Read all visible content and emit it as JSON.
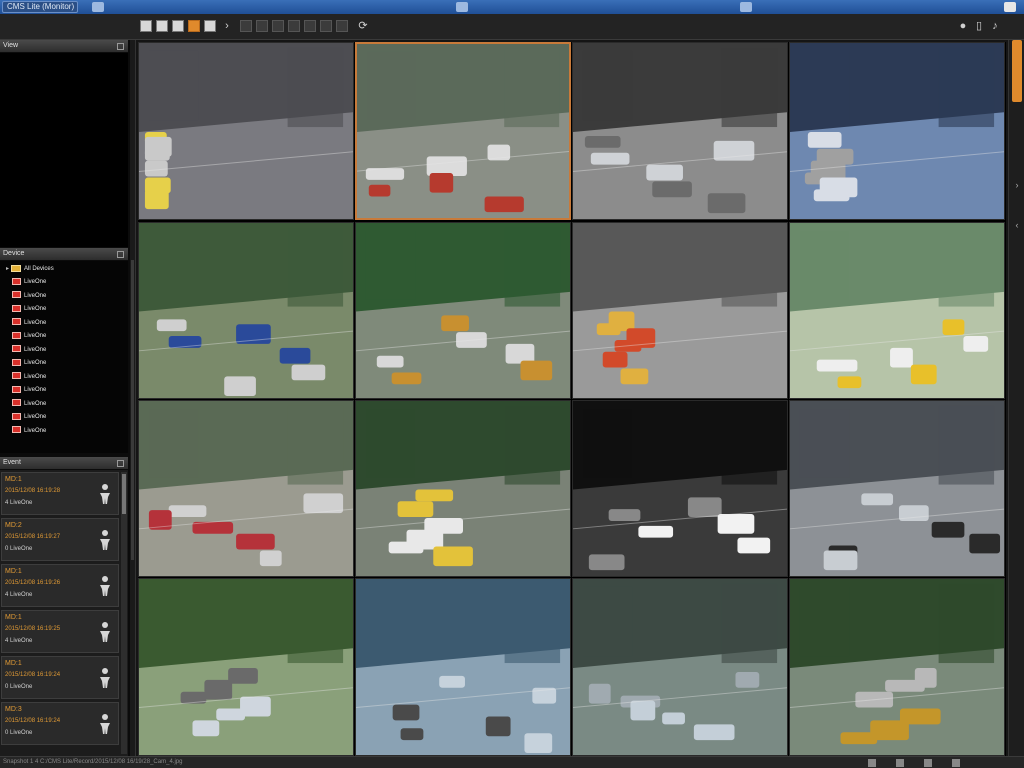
{
  "window": {
    "title": "CMS Lite (Monitor)"
  },
  "toolbar": {
    "layout_buttons": [
      "layout-1",
      "layout-4",
      "layout-6",
      "layout-9",
      "layout-16",
      "layout-next"
    ],
    "right_icons": [
      "lock-icon",
      "document-icon",
      "wrench-icon"
    ]
  },
  "panels": {
    "view_title": "View",
    "devices_title": "Device",
    "event_title": "Event"
  },
  "devices": {
    "root": "All Devices",
    "items": [
      "LiveOne",
      "LiveOne",
      "LiveOne",
      "LiveOne",
      "LiveOne",
      "LiveOne",
      "LiveOne",
      "LiveOne",
      "LiveOne",
      "LiveOne",
      "LiveOne",
      "LiveOne"
    ]
  },
  "events": [
    {
      "type": "MD:1",
      "time": "2015/12/08 16:19:28",
      "source": "4 LiveOne"
    },
    {
      "type": "MD:2",
      "time": "2015/12/08 16:19:27",
      "source": "0 LiveOne"
    },
    {
      "type": "MD:1",
      "time": "2015/12/08 16:19:26",
      "source": "4 LiveOne"
    },
    {
      "type": "MD:1",
      "time": "2015/12/08 16:19:25",
      "source": "4 LiveOne"
    },
    {
      "type": "MD:1",
      "time": "2015/12/08 16:19:24",
      "source": "0 LiveOne"
    },
    {
      "type": "MD:3",
      "time": "2015/12/08 16:19:24",
      "source": "0 LiveOne"
    }
  ],
  "status": {
    "text": "Snapshot 1 4  C:/CMS Lite/Record/2015/12/08 16/19/28_Cam_4.jpg"
  },
  "grid": {
    "selected_index": 1,
    "cameras": [
      "camera-street-intersection",
      "camera-bus-stop",
      "camera-parking-car",
      "camera-shop-counter",
      "camera-scooter-lot",
      "camera-gas-station",
      "camera-traffic-buses",
      "camera-taxi-gate",
      "camera-sidewalk-truck",
      "camera-crosswalk",
      "camera-white-sedan",
      "camera-parking-street",
      "camera-park-walkway",
      "camera-office-towers",
      "camera-office-desks",
      "camera-rooftop-ramp"
    ]
  },
  "colors": {
    "accent": "#e08a2c",
    "event_text": "#e09a35",
    "titlebar": "#2a5aa0"
  }
}
